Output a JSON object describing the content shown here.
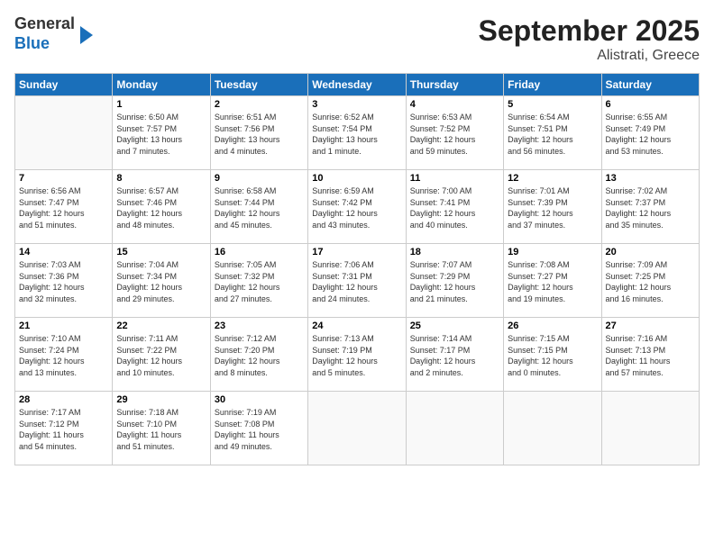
{
  "logo": {
    "line1": "General",
    "line2": "Blue"
  },
  "title": "September 2025",
  "subtitle": "Alistrati, Greece",
  "weekdays": [
    "Sunday",
    "Monday",
    "Tuesday",
    "Wednesday",
    "Thursday",
    "Friday",
    "Saturday"
  ],
  "weeks": [
    [
      {
        "day": "",
        "info": ""
      },
      {
        "day": "1",
        "info": "Sunrise: 6:50 AM\nSunset: 7:57 PM\nDaylight: 13 hours\nand 7 minutes."
      },
      {
        "day": "2",
        "info": "Sunrise: 6:51 AM\nSunset: 7:56 PM\nDaylight: 13 hours\nand 4 minutes."
      },
      {
        "day": "3",
        "info": "Sunrise: 6:52 AM\nSunset: 7:54 PM\nDaylight: 13 hours\nand 1 minute."
      },
      {
        "day": "4",
        "info": "Sunrise: 6:53 AM\nSunset: 7:52 PM\nDaylight: 12 hours\nand 59 minutes."
      },
      {
        "day": "5",
        "info": "Sunrise: 6:54 AM\nSunset: 7:51 PM\nDaylight: 12 hours\nand 56 minutes."
      },
      {
        "day": "6",
        "info": "Sunrise: 6:55 AM\nSunset: 7:49 PM\nDaylight: 12 hours\nand 53 minutes."
      }
    ],
    [
      {
        "day": "7",
        "info": "Sunrise: 6:56 AM\nSunset: 7:47 PM\nDaylight: 12 hours\nand 51 minutes."
      },
      {
        "day": "8",
        "info": "Sunrise: 6:57 AM\nSunset: 7:46 PM\nDaylight: 12 hours\nand 48 minutes."
      },
      {
        "day": "9",
        "info": "Sunrise: 6:58 AM\nSunset: 7:44 PM\nDaylight: 12 hours\nand 45 minutes."
      },
      {
        "day": "10",
        "info": "Sunrise: 6:59 AM\nSunset: 7:42 PM\nDaylight: 12 hours\nand 43 minutes."
      },
      {
        "day": "11",
        "info": "Sunrise: 7:00 AM\nSunset: 7:41 PM\nDaylight: 12 hours\nand 40 minutes."
      },
      {
        "day": "12",
        "info": "Sunrise: 7:01 AM\nSunset: 7:39 PM\nDaylight: 12 hours\nand 37 minutes."
      },
      {
        "day": "13",
        "info": "Sunrise: 7:02 AM\nSunset: 7:37 PM\nDaylight: 12 hours\nand 35 minutes."
      }
    ],
    [
      {
        "day": "14",
        "info": "Sunrise: 7:03 AM\nSunset: 7:36 PM\nDaylight: 12 hours\nand 32 minutes."
      },
      {
        "day": "15",
        "info": "Sunrise: 7:04 AM\nSunset: 7:34 PM\nDaylight: 12 hours\nand 29 minutes."
      },
      {
        "day": "16",
        "info": "Sunrise: 7:05 AM\nSunset: 7:32 PM\nDaylight: 12 hours\nand 27 minutes."
      },
      {
        "day": "17",
        "info": "Sunrise: 7:06 AM\nSunset: 7:31 PM\nDaylight: 12 hours\nand 24 minutes."
      },
      {
        "day": "18",
        "info": "Sunrise: 7:07 AM\nSunset: 7:29 PM\nDaylight: 12 hours\nand 21 minutes."
      },
      {
        "day": "19",
        "info": "Sunrise: 7:08 AM\nSunset: 7:27 PM\nDaylight: 12 hours\nand 19 minutes."
      },
      {
        "day": "20",
        "info": "Sunrise: 7:09 AM\nSunset: 7:25 PM\nDaylight: 12 hours\nand 16 minutes."
      }
    ],
    [
      {
        "day": "21",
        "info": "Sunrise: 7:10 AM\nSunset: 7:24 PM\nDaylight: 12 hours\nand 13 minutes."
      },
      {
        "day": "22",
        "info": "Sunrise: 7:11 AM\nSunset: 7:22 PM\nDaylight: 12 hours\nand 10 minutes."
      },
      {
        "day": "23",
        "info": "Sunrise: 7:12 AM\nSunset: 7:20 PM\nDaylight: 12 hours\nand 8 minutes."
      },
      {
        "day": "24",
        "info": "Sunrise: 7:13 AM\nSunset: 7:19 PM\nDaylight: 12 hours\nand 5 minutes."
      },
      {
        "day": "25",
        "info": "Sunrise: 7:14 AM\nSunset: 7:17 PM\nDaylight: 12 hours\nand 2 minutes."
      },
      {
        "day": "26",
        "info": "Sunrise: 7:15 AM\nSunset: 7:15 PM\nDaylight: 12 hours\nand 0 minutes."
      },
      {
        "day": "27",
        "info": "Sunrise: 7:16 AM\nSunset: 7:13 PM\nDaylight: 11 hours\nand 57 minutes."
      }
    ],
    [
      {
        "day": "28",
        "info": "Sunrise: 7:17 AM\nSunset: 7:12 PM\nDaylight: 11 hours\nand 54 minutes."
      },
      {
        "day": "29",
        "info": "Sunrise: 7:18 AM\nSunset: 7:10 PM\nDaylight: 11 hours\nand 51 minutes."
      },
      {
        "day": "30",
        "info": "Sunrise: 7:19 AM\nSunset: 7:08 PM\nDaylight: 11 hours\nand 49 minutes."
      },
      {
        "day": "",
        "info": ""
      },
      {
        "day": "",
        "info": ""
      },
      {
        "day": "",
        "info": ""
      },
      {
        "day": "",
        "info": ""
      }
    ]
  ]
}
